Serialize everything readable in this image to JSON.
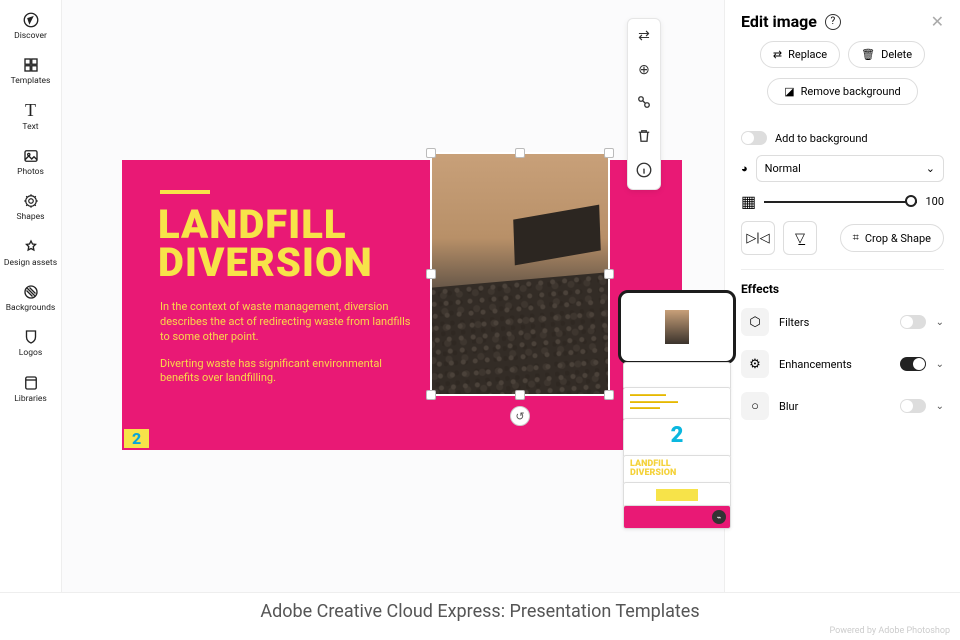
{
  "sidebar": {
    "items": [
      {
        "label": "Discover",
        "icon": "compass"
      },
      {
        "label": "Templates",
        "icon": "grid"
      },
      {
        "label": "Text",
        "icon": "T"
      },
      {
        "label": "Photos",
        "icon": "photo"
      },
      {
        "label": "Shapes",
        "icon": "gear"
      },
      {
        "label": "Design assets",
        "icon": "sparkle"
      },
      {
        "label": "Backgrounds",
        "icon": "hatch"
      },
      {
        "label": "Logos",
        "icon": "shield"
      },
      {
        "label": "Libraries",
        "icon": "lib"
      }
    ]
  },
  "canvas": {
    "slide": {
      "title_line1": "LANDFILL",
      "title_line2": "DIVERSION",
      "para1": "In the context of waste management, diversion describes the act of redirecting waste from landfills to some other point.",
      "para2": "Diverting waste has significant environmental benefits over landfilling.",
      "page_number": "2"
    },
    "thumbs": {
      "t3_number": "2",
      "t4_line1": "LANDFILL",
      "t4_line2": "DIVERSION"
    }
  },
  "float_toolbar": {
    "items": [
      "swap",
      "add",
      "scale",
      "delete",
      "info"
    ]
  },
  "panel": {
    "title": "Edit image",
    "replace": "Replace",
    "delete": "Delete",
    "remove_bg": "Remove background",
    "add_to_bg": "Add to background",
    "blend_mode": "Normal",
    "opacity_value": "100",
    "crop_shape": "Crop & Shape",
    "effects_title": "Effects",
    "effects": [
      {
        "label": "Filters",
        "on": false
      },
      {
        "label": "Enhancements",
        "on": true
      },
      {
        "label": "Blur",
        "on": false
      }
    ]
  },
  "caption": "Adobe Creative Cloud Express: Presentation Templates",
  "powered": "Powered by Adobe Photoshop"
}
